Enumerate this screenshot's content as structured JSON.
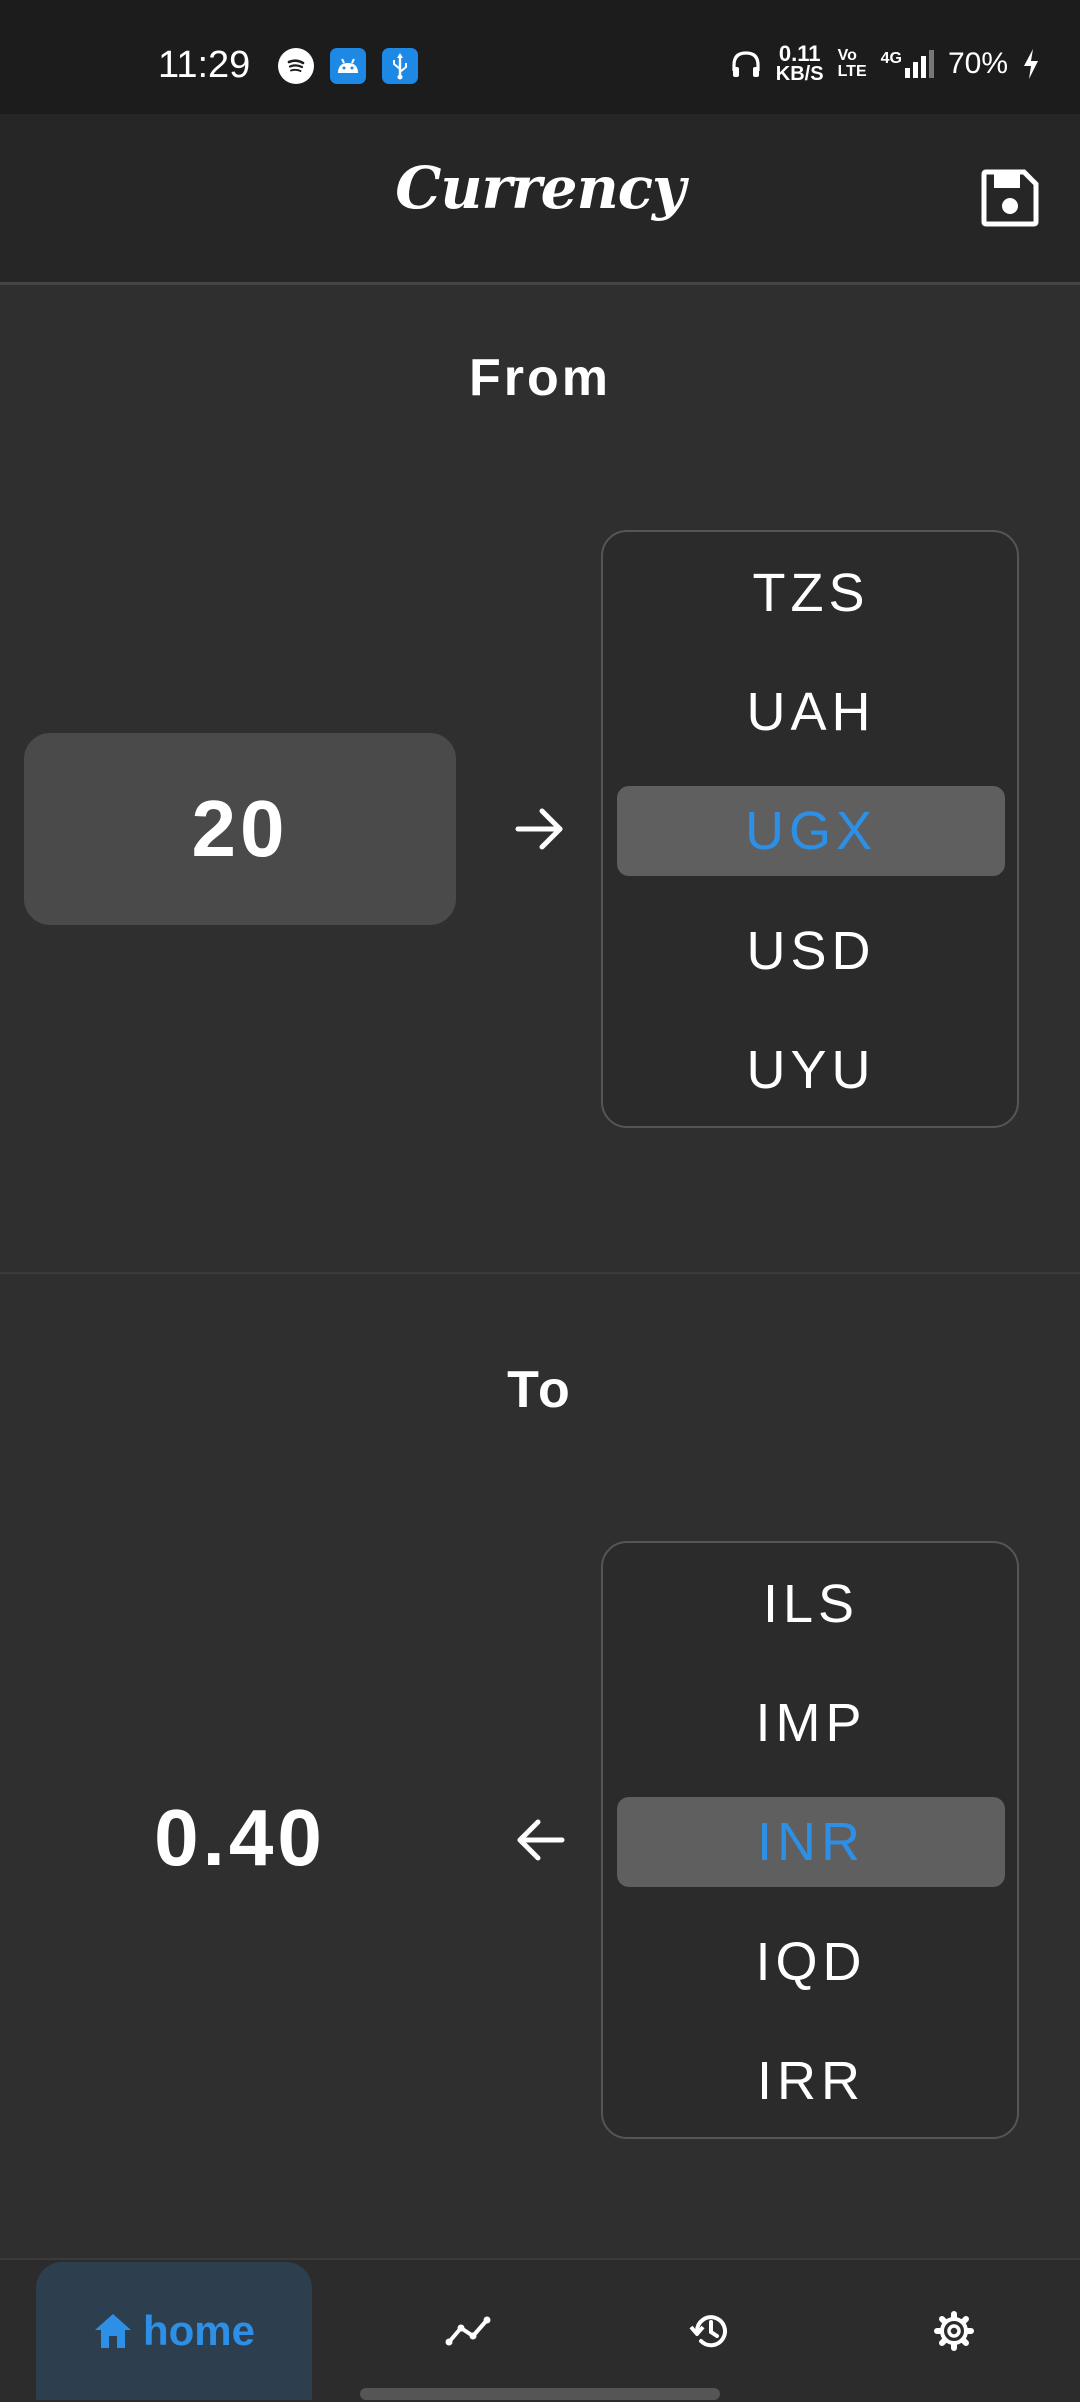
{
  "status_bar": {
    "time": "11:29",
    "net_speed_value": "0.11",
    "net_speed_unit": "KB/S",
    "volte_top": "Vo",
    "volte_bottom": "LTE",
    "network": "4G",
    "battery": "70%"
  },
  "app_bar": {
    "title": "Currency",
    "save_icon": "save-icon"
  },
  "from_section": {
    "title": "From",
    "amount": "20",
    "arrow_icon": "arrow-right-icon",
    "currencies": [
      "TZS",
      "UAH",
      "UGX",
      "USD",
      "UYU"
    ],
    "selected": "UGX"
  },
  "to_section": {
    "title": "To",
    "result": "0.40",
    "arrow_icon": "arrow-left-icon",
    "currencies": [
      "ILS",
      "IMP",
      "INR",
      "IQD",
      "IRR"
    ],
    "selected": "INR"
  },
  "bottom_nav": {
    "items": [
      {
        "icon": "home-icon",
        "label": "home",
        "active": true
      },
      {
        "icon": "trending-icon",
        "label": ""
      },
      {
        "icon": "history-icon",
        "label": ""
      },
      {
        "icon": "settings-icon",
        "label": ""
      }
    ]
  },
  "colors": {
    "accent": "#2e8fe6",
    "background": "#2f2f2f",
    "app_bar": "#262626",
    "selected_row": "#5f5f5f"
  }
}
